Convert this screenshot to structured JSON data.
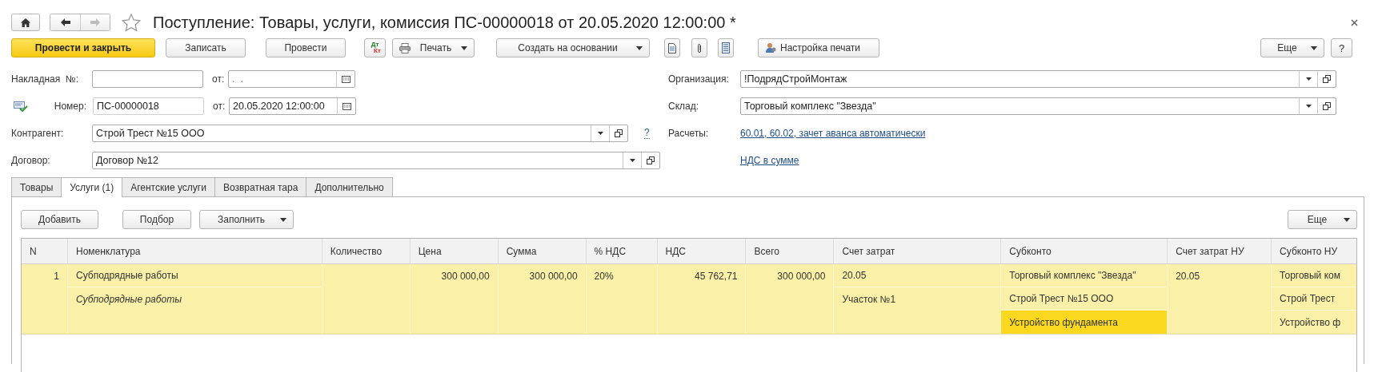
{
  "nav": {
    "forward_disabled": true
  },
  "favorite": false,
  "title": "Поступление: Товары, услуги, комиссия ПС-00000018 от 20.05.2020 12:00:00 *",
  "toolbar": [
    {
      "kind": "primary",
      "label": "Провести и закрыть"
    },
    {
      "kind": "button",
      "label": "Записать"
    },
    {
      "kind": "button",
      "label": "Провести"
    },
    {
      "kind": "dtkt",
      "top": "Дт",
      "bottom": "Кт"
    },
    {
      "kind": "print_menu",
      "label": "Печать"
    },
    {
      "kind": "menu",
      "label": "Создать на основании"
    },
    {
      "kind": "document"
    },
    {
      "kind": "clip"
    },
    {
      "kind": "list"
    },
    {
      "kind": "print_setup",
      "label": "Настройка печати"
    }
  ],
  "toolbar_right": [
    {
      "kind": "menu",
      "label": "Еще"
    },
    {
      "kind": "button",
      "label": "?"
    }
  ],
  "invoice": {
    "label": "Накладная  №:",
    "date_label": "от:",
    "date_placeholder": ".  ."
  },
  "document": {
    "label": "Номер:",
    "number": "ПС-00000018",
    "date_label": "от:",
    "date": "20.05.2020 12:00:00"
  },
  "counterparty": {
    "label": "Контрагент:",
    "value": "Строй Трест №15 ООО",
    "help": "?"
  },
  "contract": {
    "label": "Договор:",
    "value": "Договор №12"
  },
  "organization": {
    "label": "Организация:",
    "value": "!ПодрядСтройМонтаж"
  },
  "warehouse": {
    "label": "Склад:",
    "value": "Торговый комплекс \"Звезда\""
  },
  "settlements": {
    "label": "Расчеты:",
    "link": "60.01, 60.02, зачет аванса автоматически"
  },
  "vat_link": "НДС в сумме",
  "tabs": [
    {
      "label": "Товары",
      "selected": false
    },
    {
      "label": "Услуги (1)",
      "selected": true
    },
    {
      "label": "Агентские услуги",
      "selected": false
    },
    {
      "label": "Возвратная тара",
      "selected": false
    },
    {
      "label": "Дополнительно",
      "selected": false
    }
  ],
  "tab_toolbar": [
    {
      "kind": "button",
      "label": "Добавить"
    },
    {
      "kind": "button",
      "label": "Подбор"
    },
    {
      "kind": "menu",
      "label": "Заполнить"
    }
  ],
  "tab_toolbar_right": [
    {
      "kind": "menu",
      "label": "Еще"
    }
  ],
  "table": {
    "columns": [
      "N",
      "Номенклатура",
      "Количество",
      "Цена",
      "Сумма",
      "% НДС",
      "НДС",
      "Всего",
      "Счет затрат",
      "Субконто",
      "Счет затрат НУ",
      "Субконто НУ"
    ],
    "rows": [
      {
        "selected": true,
        "cells": [
          [
            {
              "text": "1",
              "italic": false,
              "current": false
            }
          ],
          [
            {
              "text": "Субподрядные работы",
              "italic": false,
              "current": false
            },
            {
              "text": "Субподрядные работы",
              "italic": true,
              "current": false
            }
          ],
          [],
          [
            {
              "text": "300 000,00",
              "italic": false,
              "current": false
            }
          ],
          [
            {
              "text": "300 000,00",
              "italic": false,
              "current": false
            }
          ],
          [
            {
              "text": "20%",
              "italic": false,
              "current": false
            }
          ],
          [
            {
              "text": "45 762,71",
              "italic": false,
              "current": false
            }
          ],
          [
            {
              "text": "300 000,00",
              "italic": false,
              "current": false
            }
          ],
          [
            {
              "text": "20.05",
              "italic": false,
              "current": false
            },
            {
              "text": "Участок №1",
              "italic": false,
              "current": false
            }
          ],
          [
            {
              "text": "Торговый комплекс \"Звезда\"",
              "italic": false,
              "current": false
            },
            {
              "text": "Строй Трест №15 ООО",
              "italic": false,
              "current": false
            },
            {
              "text": "Устройство фундамента",
              "italic": false,
              "current": true
            }
          ],
          [
            {
              "text": "20.05",
              "italic": false,
              "current": false
            }
          ],
          [
            {
              "text": "Торговый ком",
              "italic": false,
              "current": false
            },
            {
              "text": "Строй Трест",
              "italic": false,
              "current": false
            },
            {
              "text": "Устройство ф",
              "italic": false,
              "current": false
            }
          ]
        ]
      }
    ]
  }
}
